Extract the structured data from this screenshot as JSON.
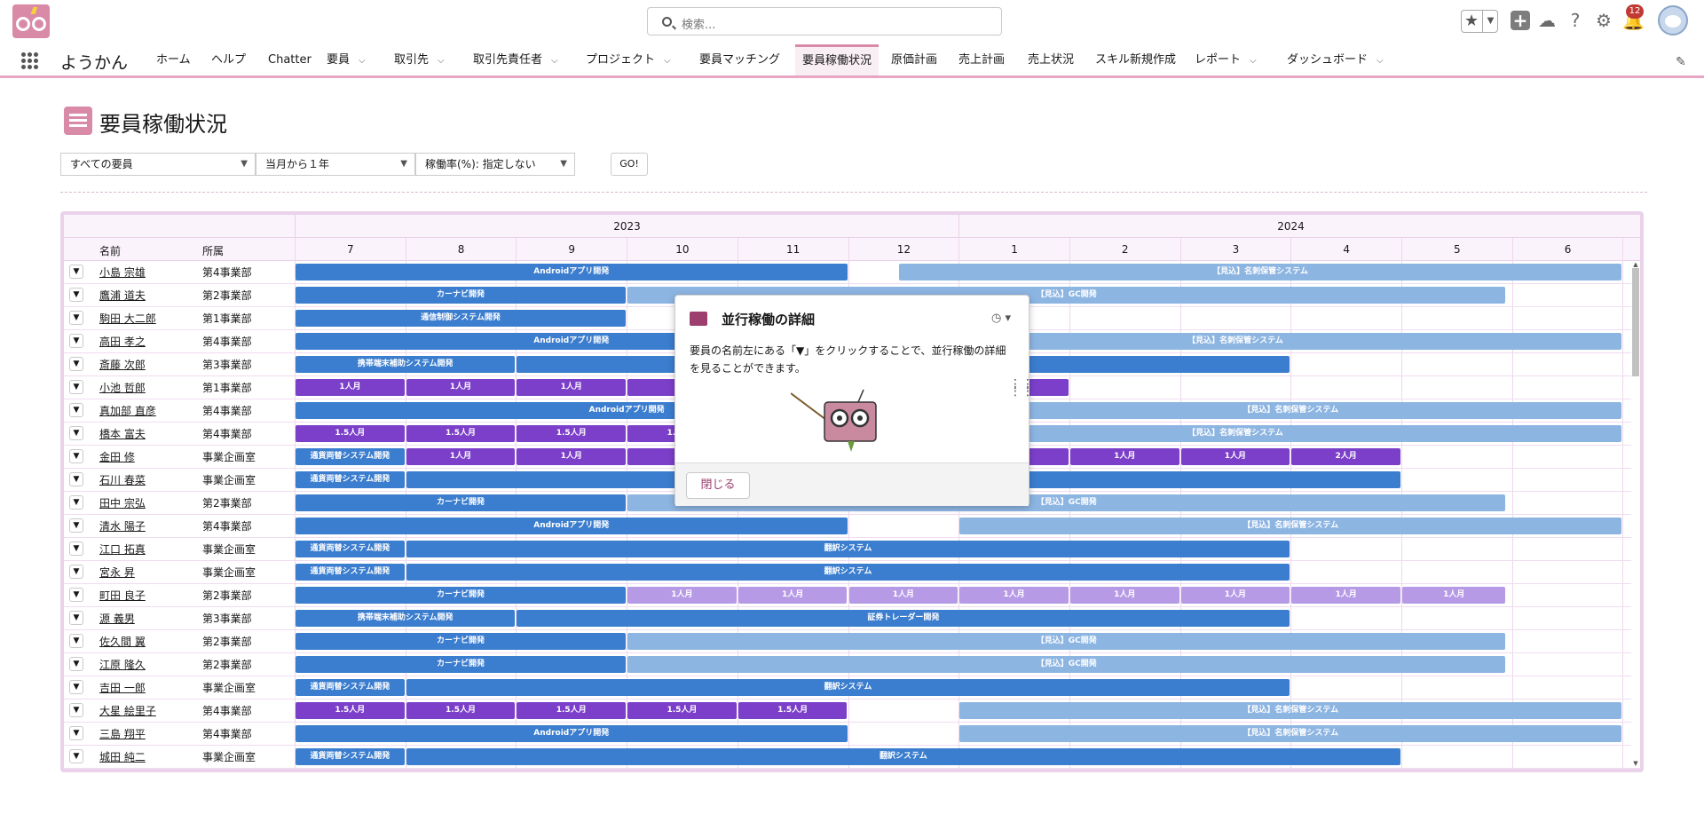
{
  "header": {
    "search_placeholder": "検索...",
    "notification_count": "12"
  },
  "nav": {
    "app_name": "ようかん",
    "items": [
      {
        "label": "ホーム",
        "chevron": false
      },
      {
        "label": "ヘルプ",
        "chevron": false
      },
      {
        "label": "Chatter",
        "chevron": false
      },
      {
        "label": "要員",
        "chevron": true
      },
      {
        "label": "取引先",
        "chevron": true
      },
      {
        "label": "取引先責任者",
        "chevron": true
      },
      {
        "label": "プロジェクト",
        "chevron": true
      },
      {
        "label": "要員マッチング",
        "chevron": false
      },
      {
        "label": "要員稼働状況",
        "chevron": false,
        "active": true
      },
      {
        "label": "原価計画",
        "chevron": false
      },
      {
        "label": "売上計画",
        "chevron": false
      },
      {
        "label": "売上状況",
        "chevron": false
      },
      {
        "label": "スキル新規作成",
        "chevron": false
      },
      {
        "label": "レポート",
        "chevron": true
      },
      {
        "label": "ダッシュボード",
        "chevron": true
      }
    ]
  },
  "page": {
    "title": "要員稼働状況"
  },
  "filters": {
    "member": "すべての要員",
    "period": "当月から１年",
    "rate": "稼働率(%): 指定しない",
    "go_label": "GO!"
  },
  "grid": {
    "years": [
      "2023",
      "2024"
    ],
    "months": [
      "7",
      "8",
      "9",
      "10",
      "11",
      "12",
      "1",
      "2",
      "3",
      "4",
      "5",
      "6"
    ],
    "col_name": "名前",
    "col_dept": "所属",
    "rows": [
      {
        "name": "小島 宗雄",
        "dept": "第4事業部"
      },
      {
        "name": "鷹浦 道夫",
        "dept": "第2事業部"
      },
      {
        "name": "駒田 大二郎",
        "dept": "第1事業部"
      },
      {
        "name": "高田 孝之",
        "dept": "第4事業部"
      },
      {
        "name": "斎藤 次郎",
        "dept": "第3事業部"
      },
      {
        "name": "小池 哲郎",
        "dept": "第1事業部"
      },
      {
        "name": "真加部 直彦",
        "dept": "第4事業部"
      },
      {
        "name": "橋本 富夫",
        "dept": "第4事業部"
      },
      {
        "name": "金田 修",
        "dept": "事業企画室"
      },
      {
        "name": "石川 春菜",
        "dept": "事業企画室"
      },
      {
        "name": "田中 宗弘",
        "dept": "第2事業部"
      },
      {
        "name": "清水 陽子",
        "dept": "第4事業部"
      },
      {
        "name": "江口 拓真",
        "dept": "事業企画室"
      },
      {
        "name": "宮永 昇",
        "dept": "事業企画室"
      },
      {
        "name": "町田 良子",
        "dept": "第2事業部"
      },
      {
        "name": "源 義男",
        "dept": "第3事業部"
      },
      {
        "name": "佐久間 翼",
        "dept": "第2事業部"
      },
      {
        "name": "江原 隆久",
        "dept": "第2事業部"
      },
      {
        "name": "吉田 一郎",
        "dept": "事業企画室"
      },
      {
        "name": "大星 絵里子",
        "dept": "第4事業部"
      },
      {
        "name": "三島 翔平",
        "dept": "第4事業部"
      },
      {
        "name": "城田 純二",
        "dept": "事業企画室"
      }
    ],
    "bars": [
      [
        {
          "s": 0,
          "e": 5,
          "t": "d",
          "l": "Androidアプリ開発"
        },
        {
          "s": 5.45,
          "e": 12,
          "t": "l",
          "l": "【見込】名刺保管システム"
        }
      ],
      [
        {
          "s": 0,
          "e": 3,
          "t": "d",
          "l": "カーナビ開発"
        },
        {
          "s": 3,
          "e": 10.95,
          "t": "l",
          "l": "【見込】GC開発"
        }
      ],
      [
        {
          "s": 0,
          "e": 3,
          "t": "d",
          "l": "通信制御システム開発"
        }
      ],
      [
        {
          "s": 0,
          "e": 5,
          "t": "d",
          "l": "Androidアプリ開発"
        },
        {
          "s": 5,
          "e": 12,
          "t": "l",
          "l": "【見込】名刺保管システム"
        }
      ],
      [
        {
          "s": 0,
          "e": 2,
          "t": "d",
          "l": "携帯端末補助システム開発"
        },
        {
          "s": 2,
          "e": 9,
          "t": "d",
          "l": ""
        }
      ],
      [
        {
          "s": 0,
          "e": 1,
          "t": "p",
          "l": "1人月"
        },
        {
          "s": 1,
          "e": 2,
          "t": "p",
          "l": "1人月"
        },
        {
          "s": 2,
          "e": 3,
          "t": "p",
          "l": "1人月"
        },
        {
          "s": 3,
          "e": 7,
          "t": "p",
          "l": ""
        }
      ],
      [
        {
          "s": 0,
          "e": 6,
          "t": "d",
          "l": "Androidアプリ開発"
        },
        {
          "s": 6,
          "e": 12,
          "t": "l",
          "l": "【見込】名刺保管システム"
        }
      ],
      [
        {
          "s": 0,
          "e": 1,
          "t": "p",
          "l": "1.5人月"
        },
        {
          "s": 1,
          "e": 2,
          "t": "p",
          "l": "1.5人月"
        },
        {
          "s": 2,
          "e": 3,
          "t": "p",
          "l": "1.5人月"
        },
        {
          "s": 3,
          "e": 4,
          "t": "p",
          "l": "1.5人月"
        },
        {
          "s": 5,
          "e": 12,
          "t": "l",
          "l": "【見込】名刺保管システム"
        }
      ],
      [
        {
          "s": 0,
          "e": 1,
          "t": "d",
          "l": "通貨両替システム開発"
        },
        {
          "s": 1,
          "e": 2,
          "t": "p",
          "l": "1人月"
        },
        {
          "s": 2,
          "e": 3,
          "t": "p",
          "l": "1人月"
        },
        {
          "s": 3,
          "e": 4,
          "t": "p",
          "l": ""
        },
        {
          "s": 6,
          "e": 7,
          "t": "p",
          "l": ""
        },
        {
          "s": 7,
          "e": 8,
          "t": "p",
          "l": "1人月"
        },
        {
          "s": 8,
          "e": 9,
          "t": "p",
          "l": "1人月"
        },
        {
          "s": 9,
          "e": 10,
          "t": "p",
          "l": "2人月"
        }
      ],
      [
        {
          "s": 0,
          "e": 1,
          "t": "d",
          "l": "通貨両替システム開発"
        },
        {
          "s": 1,
          "e": 10,
          "t": "d",
          "l": ""
        }
      ],
      [
        {
          "s": 0,
          "e": 3,
          "t": "d",
          "l": "カーナビ開発"
        },
        {
          "s": 3,
          "e": 10.95,
          "t": "l",
          "l": "【見込】GC開発"
        }
      ],
      [
        {
          "s": 0,
          "e": 5,
          "t": "d",
          "l": "Androidアプリ開発"
        },
        {
          "s": 6,
          "e": 12,
          "t": "l",
          "l": "【見込】名刺保管システム"
        }
      ],
      [
        {
          "s": 0,
          "e": 1,
          "t": "d",
          "l": "通貨両替システム開発"
        },
        {
          "s": 1,
          "e": 9,
          "t": "d",
          "l": "翻訳システム"
        }
      ],
      [
        {
          "s": 0,
          "e": 1,
          "t": "d",
          "l": "通貨両替システム開発"
        },
        {
          "s": 1,
          "e": 9,
          "t": "d",
          "l": "翻訳システム"
        }
      ],
      [
        {
          "s": 0,
          "e": 3,
          "t": "d",
          "l": "カーナビ開発"
        },
        {
          "s": 3,
          "e": 4,
          "t": "v",
          "l": "1人月"
        },
        {
          "s": 4,
          "e": 5,
          "t": "v",
          "l": "1人月"
        },
        {
          "s": 5,
          "e": 6,
          "t": "v",
          "l": "1人月"
        },
        {
          "s": 6,
          "e": 7,
          "t": "v",
          "l": "1人月"
        },
        {
          "s": 7,
          "e": 8,
          "t": "v",
          "l": "1人月"
        },
        {
          "s": 8,
          "e": 9,
          "t": "v",
          "l": "1人月"
        },
        {
          "s": 9,
          "e": 10,
          "t": "v",
          "l": "1人月"
        },
        {
          "s": 10,
          "e": 10.95,
          "t": "v",
          "l": "1人月"
        }
      ],
      [
        {
          "s": 0,
          "e": 2,
          "t": "d",
          "l": "携帯端末補助システム開発"
        },
        {
          "s": 2,
          "e": 9,
          "t": "d",
          "l": "証券トレーダー開発"
        }
      ],
      [
        {
          "s": 0,
          "e": 3,
          "t": "d",
          "l": "カーナビ開発"
        },
        {
          "s": 3,
          "e": 10.95,
          "t": "l",
          "l": "【見込】GC開発"
        }
      ],
      [
        {
          "s": 0,
          "e": 3,
          "t": "d",
          "l": "カーナビ開発"
        },
        {
          "s": 3,
          "e": 10.95,
          "t": "l",
          "l": "【見込】GC開発"
        }
      ],
      [
        {
          "s": 0,
          "e": 1,
          "t": "d",
          "l": "通貨両替システム開発"
        },
        {
          "s": 1,
          "e": 9,
          "t": "d",
          "l": "翻訳システム"
        }
      ],
      [
        {
          "s": 0,
          "e": 1,
          "t": "p",
          "l": "1.5人月"
        },
        {
          "s": 1,
          "e": 2,
          "t": "p",
          "l": "1.5人月"
        },
        {
          "s": 2,
          "e": 3,
          "t": "p",
          "l": "1.5人月"
        },
        {
          "s": 3,
          "e": 4,
          "t": "p",
          "l": "1.5人月"
        },
        {
          "s": 4,
          "e": 5,
          "t": "p",
          "l": "1.5人月"
        },
        {
          "s": 6,
          "e": 12,
          "t": "l",
          "l": "【見込】名刺保管システム"
        }
      ],
      [
        {
          "s": 0,
          "e": 5,
          "t": "d",
          "l": "Androidアプリ開発"
        },
        {
          "s": 6,
          "e": 12,
          "t": "l",
          "l": "【見込】名刺保管システム"
        }
      ],
      [
        {
          "s": 0,
          "e": 1,
          "t": "d",
          "l": "通貨両替システム開発"
        },
        {
          "s": 1,
          "e": 10,
          "t": "d",
          "l": "翻訳システム"
        }
      ]
    ]
  },
  "popover": {
    "title": "並行稼働の詳細",
    "body": "要員の名前左にある「▼」をクリックすることで、並行稼働の詳細を見ることができます。",
    "close_label": "閉じる"
  },
  "colors": {
    "brand": "#d88aa6",
    "bar_dark": "#3b7dce",
    "bar_light": "#8db5e2",
    "bar_purple": "#7b3fc9",
    "bar_lavender": "#b79ae6"
  }
}
